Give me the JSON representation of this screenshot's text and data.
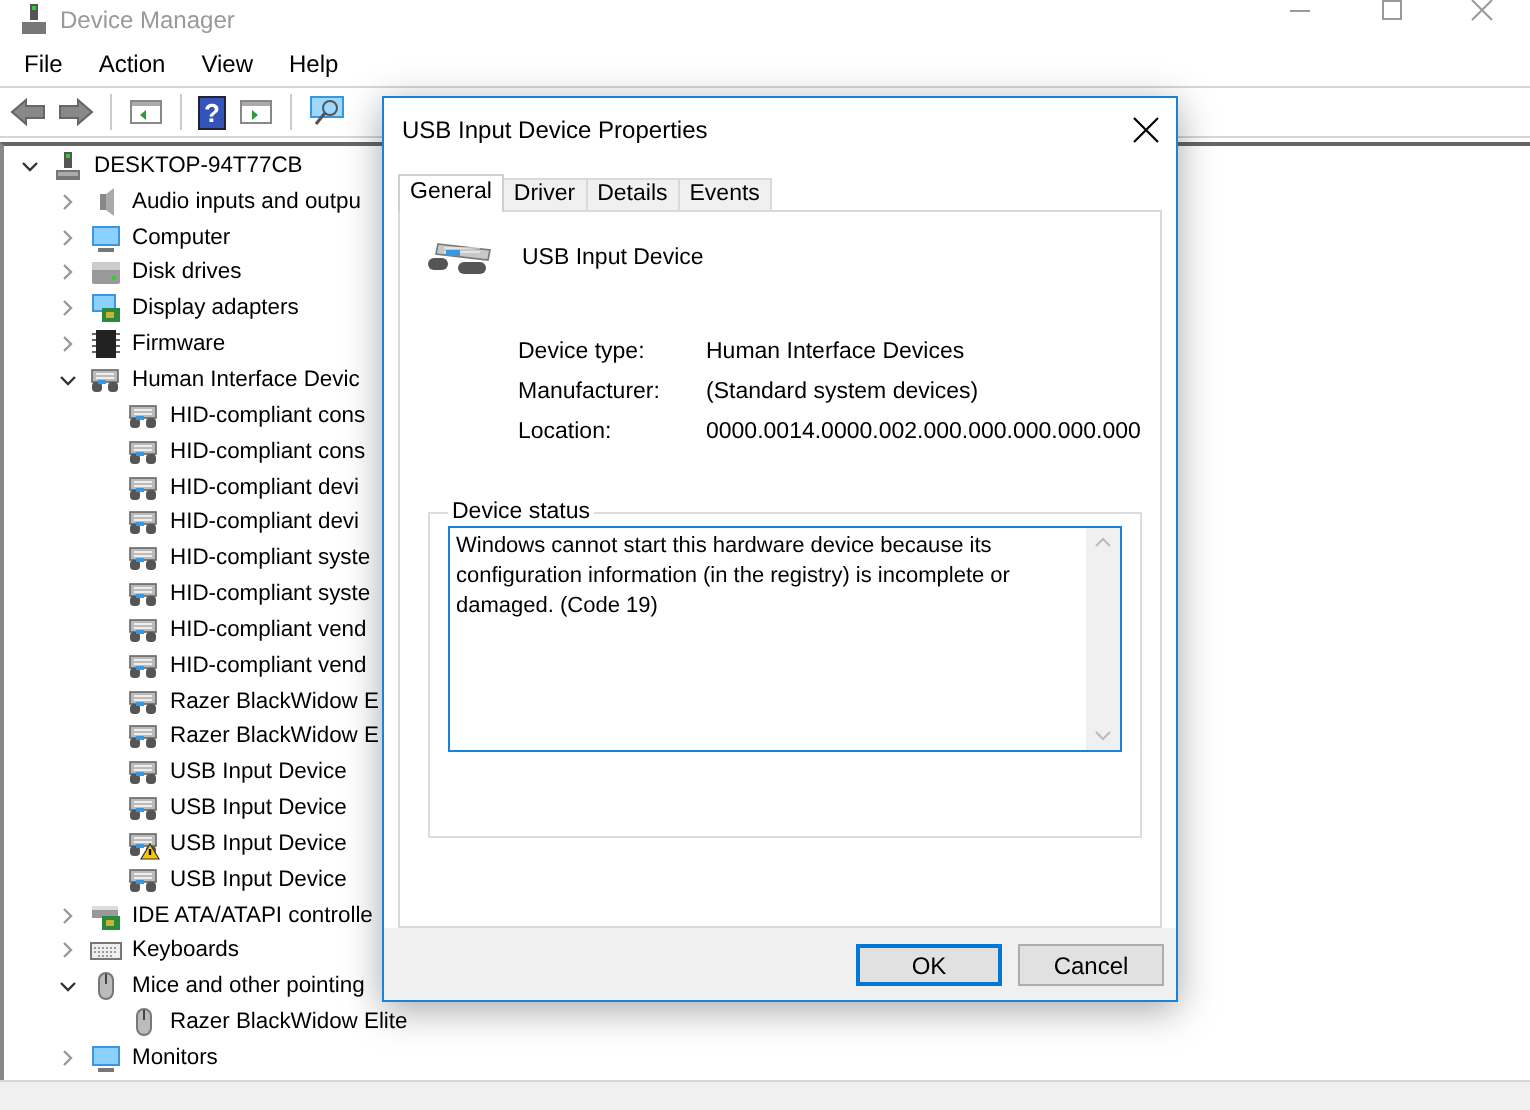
{
  "window": {
    "title": "Device Manager"
  },
  "menu": [
    "File",
    "Action",
    "View",
    "Help"
  ],
  "toolbar": [
    {
      "kind": "back"
    },
    {
      "kind": "forward"
    },
    {
      "kind": "separator"
    },
    {
      "kind": "sheet"
    },
    {
      "kind": "separator"
    },
    {
      "kind": "help",
      "label": "?"
    },
    {
      "kind": "sheet2"
    },
    {
      "kind": "separator"
    },
    {
      "kind": "scan"
    }
  ],
  "tree": {
    "label": "DESKTOP-94T77CB",
    "kind": "computer",
    "expanded": true,
    "children": [
      {
        "label": "Audio inputs and outpu",
        "kind": "audio",
        "expanded": false
      },
      {
        "label": "Computer",
        "kind": "monitor",
        "expanded": false
      },
      {
        "label": "Disk drives",
        "kind": "disk",
        "expanded": false
      },
      {
        "label": "Display adapters",
        "kind": "display",
        "expanded": false
      },
      {
        "label": "Firmware",
        "kind": "chip",
        "expanded": false
      },
      {
        "label": "Human Interface Devic",
        "kind": "hid",
        "expanded": true,
        "children": [
          {
            "label": "HID-compliant cons",
            "kind": "hid",
            "warning": false
          },
          {
            "label": "HID-compliant cons",
            "kind": "hid",
            "warning": false
          },
          {
            "label": "HID-compliant devi",
            "kind": "hid",
            "warning": false
          },
          {
            "label": "HID-compliant devi",
            "kind": "hid",
            "warning": false
          },
          {
            "label": "HID-compliant syste",
            "kind": "hid",
            "warning": false
          },
          {
            "label": "HID-compliant syste",
            "kind": "hid",
            "warning": false
          },
          {
            "label": "HID-compliant vend",
            "kind": "hid",
            "warning": false
          },
          {
            "label": "HID-compliant vend",
            "kind": "hid",
            "warning": false
          },
          {
            "label": "Razer BlackWidow E",
            "kind": "hid",
            "warning": false
          },
          {
            "label": "Razer BlackWidow E",
            "kind": "hid",
            "warning": false
          },
          {
            "label": "USB Input Device",
            "kind": "hid",
            "warning": false
          },
          {
            "label": "USB Input Device",
            "kind": "hid",
            "warning": false
          },
          {
            "label": "USB Input Device",
            "kind": "hid",
            "warning": true
          },
          {
            "label": "USB Input Device",
            "kind": "hid",
            "warning": false
          }
        ]
      },
      {
        "label": "IDE ATA/ATAPI controlle",
        "kind": "ide",
        "expanded": false
      },
      {
        "label": "Keyboards",
        "kind": "keyboard",
        "expanded": false
      },
      {
        "label": "Mice and other pointing",
        "kind": "mouse",
        "expanded": true,
        "children": [
          {
            "label": "Razer BlackWidow Elite",
            "kind": "mouse",
            "warning": false
          }
        ]
      },
      {
        "label": "Monitors",
        "kind": "monitor",
        "expanded": false
      }
    ]
  },
  "dialog": {
    "title": "USB Input Device Properties",
    "tabs": [
      {
        "label": "General",
        "selected": true
      },
      {
        "label": "Driver",
        "selected": false
      },
      {
        "label": "Details",
        "selected": false
      },
      {
        "label": "Events",
        "selected": false
      }
    ],
    "device_name": "USB Input Device",
    "properties": [
      {
        "label": "Device type:",
        "value": "Human Interface Devices"
      },
      {
        "label": "Manufacturer:",
        "value": "(Standard system devices)"
      },
      {
        "label": "Location:",
        "value": "0000.0014.0000.002.000.000.000.000.000"
      }
    ],
    "status_group": "Device status",
    "status_text": "Windows cannot start this hardware device because its configuration information (in the registry) is incomplete or damaged. (Code 19)",
    "buttons": [
      {
        "label": "OK",
        "default": true
      },
      {
        "label": "Cancel",
        "default": false
      }
    ]
  }
}
